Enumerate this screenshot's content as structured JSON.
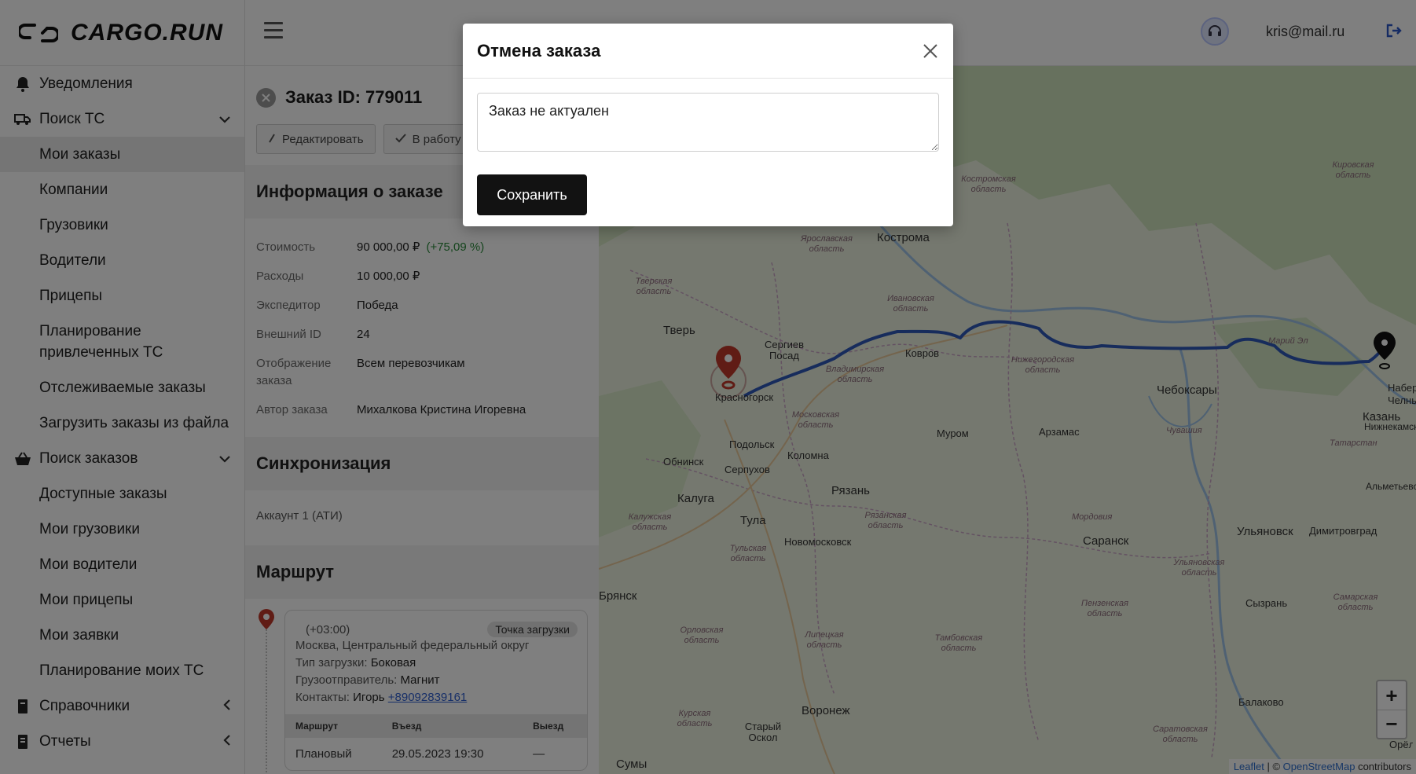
{
  "app": {
    "logo_text": "CARGO.RUN",
    "user_email": "kris@mail.ru"
  },
  "sidebar": {
    "items": [
      {
        "label": "Уведомления",
        "icon": "bell-icon",
        "type": "section"
      },
      {
        "label": "Поиск ТС",
        "icon": "truck-icon",
        "type": "section",
        "chevron": "down"
      },
      {
        "label": "Мои заказы",
        "type": "sub",
        "active": true
      },
      {
        "label": "Компании",
        "type": "sub"
      },
      {
        "label": "Грузовики",
        "type": "sub"
      },
      {
        "label": "Водители",
        "type": "sub"
      },
      {
        "label": "Прицепы",
        "type": "sub"
      },
      {
        "label": "Планирование привлеченных ТС",
        "type": "sub"
      },
      {
        "label": "Отслеживаемые заказы",
        "type": "sub"
      },
      {
        "label": "Загрузить заказы из файла",
        "type": "sub"
      },
      {
        "label": "Поиск заказов",
        "icon": "basket-icon",
        "type": "section",
        "chevron": "down"
      },
      {
        "label": "Доступные заказы",
        "type": "sub"
      },
      {
        "label": "Мои грузовики",
        "type": "sub"
      },
      {
        "label": "Мои водители",
        "type": "sub"
      },
      {
        "label": "Мои прицепы",
        "type": "sub"
      },
      {
        "label": "Мои заявки",
        "type": "sub"
      },
      {
        "label": "Планирование моих ТС",
        "type": "sub"
      },
      {
        "label": "Справочники",
        "icon": "book-icon",
        "type": "section",
        "chevron": "left"
      },
      {
        "label": "Отчеты",
        "icon": "report-icon",
        "type": "section",
        "chevron": "left"
      }
    ]
  },
  "order": {
    "title": "Заказ ID: 779011",
    "actions": {
      "edit": "Редактировать",
      "to_work": "В работу"
    },
    "info_title": "Информация о заказе",
    "info": [
      {
        "key": "Стоимость",
        "value": "90 000,00 ₽",
        "extra": "(+75,09 %)"
      },
      {
        "key": "Расходы",
        "value": "10 000,00 ₽"
      },
      {
        "key": "Экспедитор",
        "value": "Победа"
      },
      {
        "key": "Внешний ID",
        "value": "24"
      },
      {
        "key": "Отображение заказа",
        "value": "Всем перевозчикам"
      },
      {
        "key": "Автор заказа",
        "value": "Михалкова Кристина Игоревна"
      }
    ],
    "sync_title": "Синхронизация",
    "sync_account": "Аккаунт 1 (АТИ)",
    "route_title": "Маршрут",
    "stop": {
      "timezone": "(+03:00)",
      "tag": "Точка загрузки",
      "address": "Москва, Центральный федеральный округ",
      "load_type_label": "Тип загрузки:",
      "load_type": "Боковая",
      "shipper_label": "Грузоотправитель:",
      "shipper": "Магнит",
      "contacts_label": "Контакты:",
      "contact_name": "Игорь",
      "contact_phone": "+89092839161",
      "table_headers": [
        "Маршрут",
        "Въезд",
        "Выезд"
      ],
      "table_row": [
        "Плановый",
        "29.05.2023 19:30",
        "—"
      ]
    }
  },
  "map": {
    "cities": [
      {
        "name": "Кострома"
      },
      {
        "name": "Тверь"
      },
      {
        "name": "Сергиев Посад"
      },
      {
        "name": "Ковров"
      },
      {
        "name": "Чебоксары"
      },
      {
        "name": "Казань"
      },
      {
        "name": "Красногорск"
      },
      {
        "name": "Подольск"
      },
      {
        "name": "Обнинск"
      },
      {
        "name": "Серпухов"
      },
      {
        "name": "Коломна"
      },
      {
        "name": "Муром"
      },
      {
        "name": "Арзамас"
      },
      {
        "name": "Калуга"
      },
      {
        "name": "Тула"
      },
      {
        "name": "Рязань"
      },
      {
        "name": "Новомосковск"
      },
      {
        "name": "Саранск"
      },
      {
        "name": "Ульяновск"
      },
      {
        "name": "Димитровград"
      },
      {
        "name": "Сызрань"
      },
      {
        "name": "Воронеж"
      },
      {
        "name": "Балаково"
      },
      {
        "name": "Старый Оскол"
      },
      {
        "name": "Брянск"
      },
      {
        "name": "Сумы"
      },
      {
        "name": "Нижнекамск"
      },
      {
        "name": "Альметьевск"
      },
      {
        "name": "Набережные Челны"
      },
      {
        "name": "Орёл"
      }
    ],
    "regions": [
      "Костромская область",
      "Кировская область",
      "Ярославская область",
      "Тверская область",
      "Ивановская область",
      "Владимирская область",
      "Нижегородская область",
      "Марий Эл",
      "Московская область",
      "Чувашия",
      "Татарстан",
      "Калужская область",
      "Рязанская область",
      "Тульская область",
      "Мордовия",
      "Ульяновская область",
      "Пензенская область",
      "Самарская область",
      "Орловская область",
      "Липецкая область",
      "Тамбовская область",
      "Курская область",
      "Саратовская область"
    ],
    "zoom_in": "+",
    "zoom_out": "−",
    "attribution_leaflet": "Leaflet",
    "attribution_sep": " | © ",
    "attribution_osm": "OpenStreetMap",
    "attribution_suffix": " contributors"
  },
  "modal": {
    "title": "Отмена заказа",
    "reason_value": "Заказ не актуален",
    "save_label": "Сохранить"
  }
}
